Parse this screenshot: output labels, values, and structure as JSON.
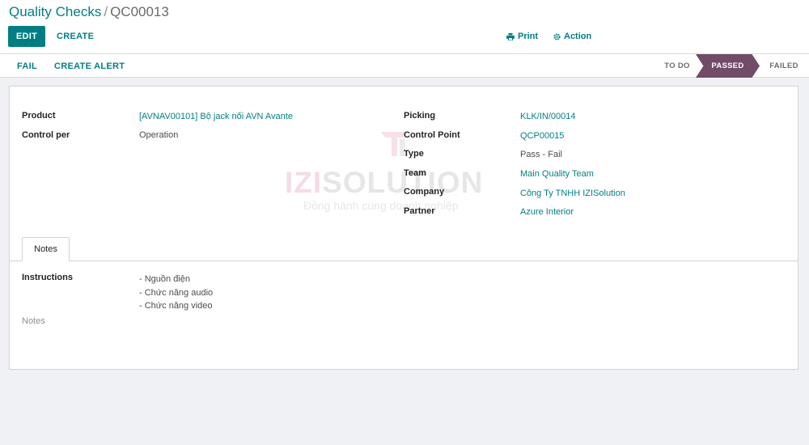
{
  "breadcrumb": {
    "parent": "Quality Checks",
    "separator": "/",
    "current": "QC00013"
  },
  "toolbar": {
    "edit_label": "EDIT",
    "create_label": "CREATE",
    "print_label": "Print",
    "action_label": "Action"
  },
  "statusbar": {
    "fail_label": "FAIL",
    "create_alert_label": "CREATE ALERT",
    "stages": [
      "TO DO",
      "PASSED",
      "FAILED"
    ],
    "active_stage": "PASSED"
  },
  "watermark": {
    "brand_accent": "IZI",
    "brand_rest": "SOLUTION",
    "tagline": "Đồng hành cùng doanh nghiệp"
  },
  "form": {
    "left": [
      {
        "label": "Product",
        "value": "[AVNAV00101] Bộ jack nối AVN Avante"
      },
      {
        "label": "Control per",
        "value": "Operation"
      }
    ],
    "right": [
      {
        "label": "Picking",
        "value": "KLK/IN/00014"
      },
      {
        "label": "Control Point",
        "value": "QCP00015"
      },
      {
        "label": "Type",
        "value": "Pass - Fail"
      },
      {
        "label": "Team",
        "value": "Main Quality Team"
      },
      {
        "label": "Company",
        "value": "Công Ty TNHH IZISolution"
      },
      {
        "label": "Partner",
        "value": "Azure Interior"
      }
    ]
  },
  "tabs": {
    "notes_tab": "Notes"
  },
  "instructions": {
    "label": "Instructions",
    "lines": [
      "- Nguồn điện",
      "- Chức năng audio",
      "- Chức năng video"
    ]
  },
  "notes": {
    "placeholder": "Notes"
  },
  "colors": {
    "primary": "#017e84",
    "stage_active": "#714b67",
    "background": "#f0f1f4"
  }
}
